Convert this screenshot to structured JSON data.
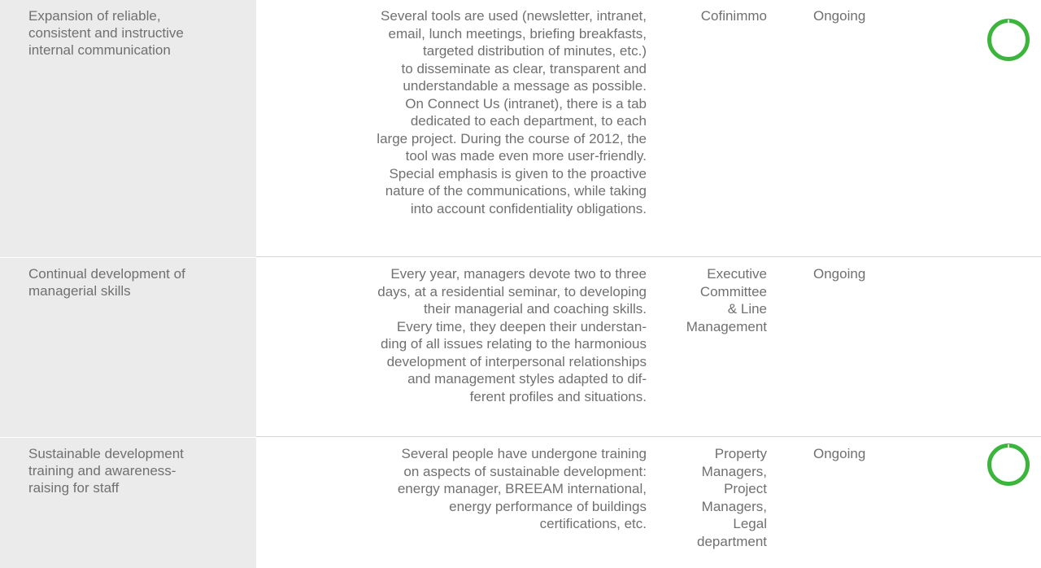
{
  "colors": {
    "objective_bg": "#ebebeb",
    "text": "#707070",
    "divider": "#d4d4d4",
    "status_ring": "#3cb53c"
  },
  "rows": [
    {
      "objective": [
        "Expansion of reliable,",
        "consistent and instructive",
        "internal communication"
      ],
      "description": [
        "Several tools are used (newsletter, intranet,",
        "email, lunch meetings, briefing breakfasts,",
        "targeted distribution of minutes, etc.)",
        "to disseminate as clear, transparent and",
        "understandable a message as possible.",
        "On Connect Us (intranet), there is a tab",
        "dedicated to each department, to each",
        "large project. During the course of 2012, the",
        "tool was made even more user-friendly.",
        "Special emphasis is given to the proactive",
        "nature of the communications, while taking",
        "into account confidentiality obligations."
      ],
      "responsible": [
        "Cofinimmo"
      ],
      "status": "Ongoing",
      "status_icon": "progress-ring-icon"
    },
    {
      "objective": [
        "Continual development of",
        "managerial skills"
      ],
      "description": [
        "Every year, managers devote two to three",
        "days, at a residential seminar, to developing",
        "their managerial and coaching skills.",
        "Every time, they deepen their understan-",
        "ding of all issues relating to the harmonious",
        "development of interpersonal relationships",
        "and management styles adapted to dif-",
        "ferent profiles and situations."
      ],
      "responsible": [
        "Executive",
        "Committee",
        "& Line",
        "Management"
      ],
      "status": "Ongoing",
      "status_icon": null
    },
    {
      "objective": [
        "Sustainable development",
        "training and awareness-",
        "raising for staff"
      ],
      "description": [
        "Several people have undergone training",
        "on aspects of sustainable development:",
        "energy manager, BREEAM international,",
        "energy performance of buildings",
        "certifications, etc."
      ],
      "responsible": [
        "Property",
        "Managers,",
        "Project",
        "Managers,",
        "Legal",
        "department"
      ],
      "status": "Ongoing",
      "status_icon": "progress-ring-icon"
    }
  ]
}
